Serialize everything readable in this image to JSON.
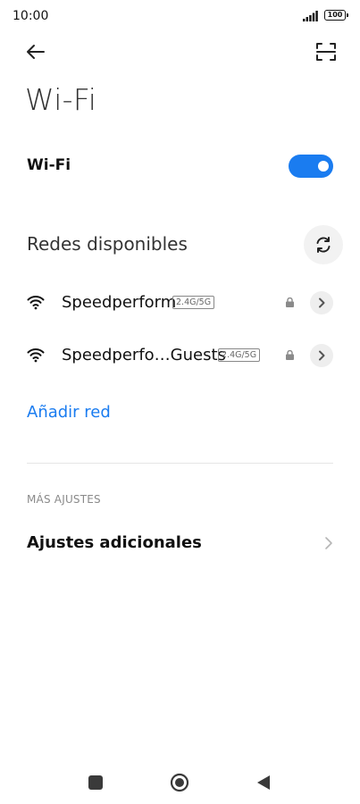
{
  "status_bar": {
    "time": "10:00",
    "battery": "100"
  },
  "header": {
    "title": "Wi-Fi"
  },
  "wifi_toggle": {
    "label": "Wi-Fi",
    "enabled": true,
    "accent_color": "#1a7cf0"
  },
  "networks": {
    "header": "Redes disponibles",
    "items": [
      {
        "name": "Speedperform",
        "band": "2.4G/5G",
        "secured": true
      },
      {
        "name": "Speedperfo…Guests",
        "band": "2.4G/5G",
        "secured": true
      }
    ]
  },
  "add_network": {
    "label": "Añadir red"
  },
  "more_settings": {
    "section_title": "MÁS AJUSTES",
    "additional_label": "Ajustes adicionales"
  },
  "icons": {
    "back": "arrow-left-icon",
    "scan": "qr-scan-icon",
    "refresh": "refresh-icon",
    "wifi": "wifi-icon",
    "lock": "lock-icon",
    "details": "chevron-right-icon"
  }
}
